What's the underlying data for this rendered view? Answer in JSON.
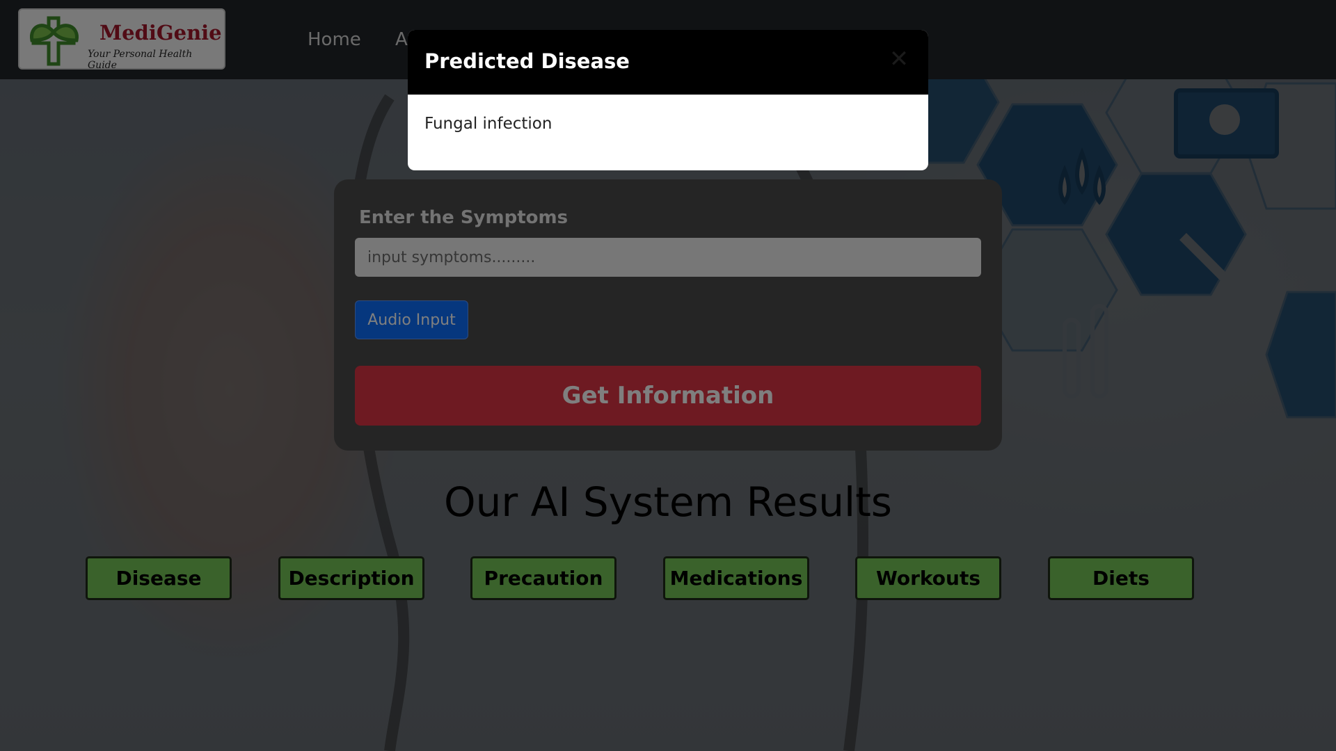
{
  "navbar": {
    "logo": {
      "name": "MediGenie",
      "tagline": "Your Personal Health Guide"
    },
    "links": [
      {
        "label": "Home"
      },
      {
        "label": "A"
      }
    ]
  },
  "form": {
    "label": "Enter the Symptoms",
    "input_placeholder": "input symptoms.........",
    "input_value": "",
    "audio_button": "Audio Input",
    "submit_button": "Get Information"
  },
  "results": {
    "title": "Our AI System Results",
    "buttons": [
      {
        "label": "Disease"
      },
      {
        "label": "Description"
      },
      {
        "label": "Precaution"
      },
      {
        "label": "Medications"
      },
      {
        "label": "Workouts"
      },
      {
        "label": "Diets"
      }
    ]
  },
  "modal": {
    "title": "Predicted Disease",
    "close_icon": "close-icon",
    "body": "Fungal infection"
  },
  "colors": {
    "navbar": "#212529",
    "logo_text": "#a3172a",
    "audio_button": "#0d6efd",
    "submit_button": "#dc3545",
    "result_button": "#74c556",
    "modal_header": "#000000"
  }
}
